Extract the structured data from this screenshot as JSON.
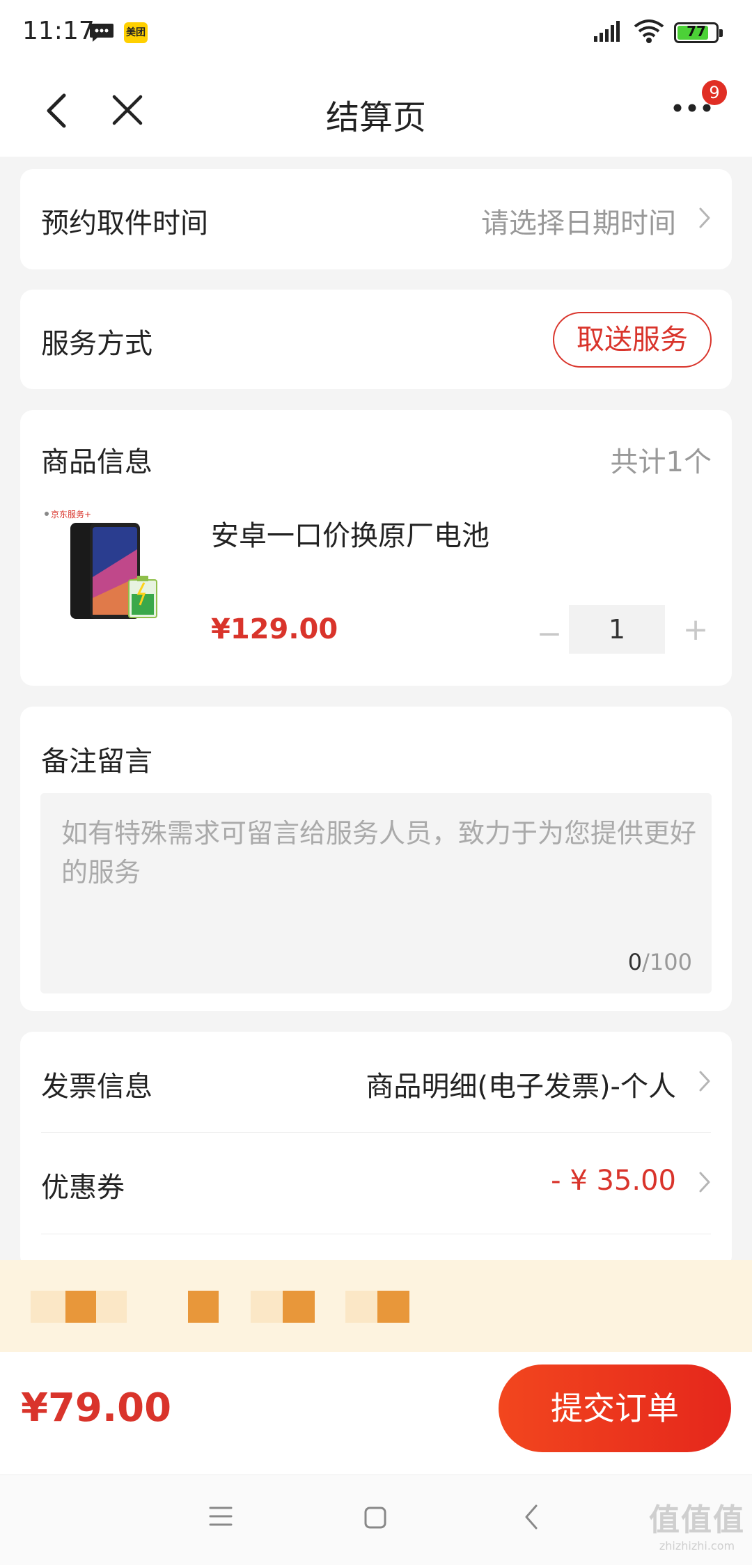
{
  "status_bar": {
    "time": "11:17",
    "battery": "77",
    "app_badge": "美团"
  },
  "header": {
    "title": "结算页",
    "badge_count": "9"
  },
  "pickup_time": {
    "label": "预约取件时间",
    "placeholder": "请选择日期时间"
  },
  "service_mode": {
    "label": "服务方式",
    "option": "取送服务"
  },
  "product": {
    "section_label": "商品信息",
    "total_count": "共计1个",
    "image_brand": "京东服务+",
    "name": "安卓一口价换原厂电池",
    "price": "¥129.00",
    "quantity": "1",
    "minus_label": "−",
    "plus_label": "+"
  },
  "note": {
    "label": "备注留言",
    "placeholder": "如有特殊需求可留言给服务人员，致力于为您提供更好的服务",
    "count_current": "0",
    "count_max": "/100"
  },
  "invoice": {
    "label": "发票信息",
    "value": "商品明细(电子发票)-个人"
  },
  "coupon": {
    "label": "优惠券",
    "value": "- ¥ 35.00"
  },
  "footer": {
    "total": "¥79.00",
    "submit_label": "提交订单"
  },
  "watermark": {
    "logo": "值值值",
    "url": "zhizhizhi.com"
  },
  "colors": {
    "accent_red": "#d9342b",
    "submit_gradient_start": "#f2461e",
    "promo_strip": "#fdf3df",
    "promo_block": "#e8973a"
  }
}
